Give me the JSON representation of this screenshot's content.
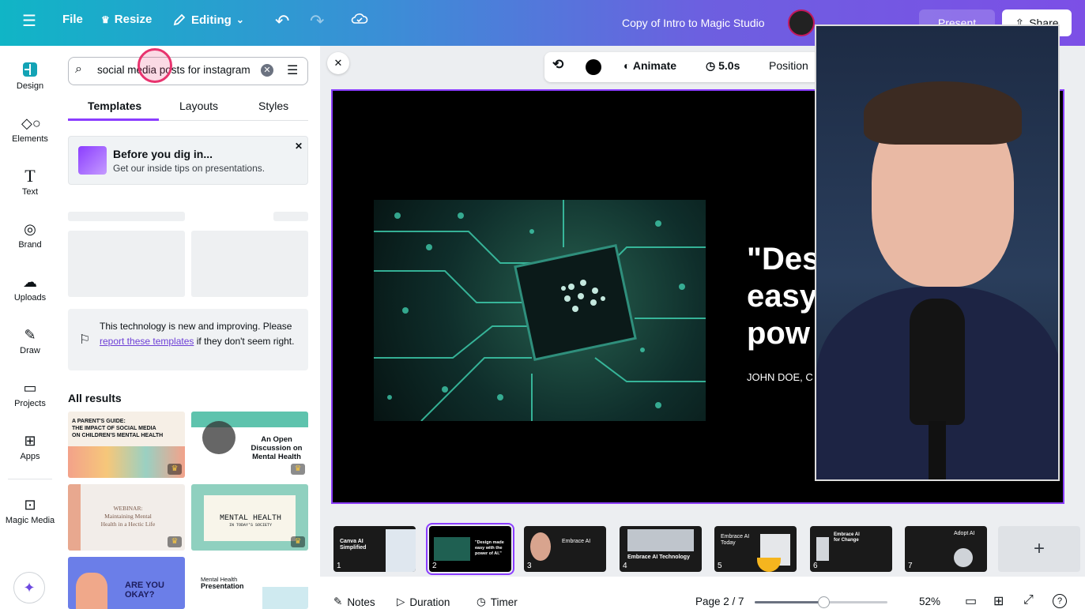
{
  "topbar": {
    "file_label": "File",
    "resize_label": "Resize",
    "editing_label": "Editing",
    "doc_title": "Copy of Intro to Magic Studio",
    "present_label": "Present",
    "share_label": "Share",
    "gradient_start": "#10b5c6",
    "gradient_end": "#7c4fe6"
  },
  "rail": {
    "items": [
      {
        "label": "Design",
        "icon": "design-icon"
      },
      {
        "label": "Elements",
        "icon": "elements-icon"
      },
      {
        "label": "Text",
        "icon": "text-icon"
      },
      {
        "label": "Brand",
        "icon": "brand-icon"
      },
      {
        "label": "Uploads",
        "icon": "uploads-icon"
      },
      {
        "label": "Draw",
        "icon": "draw-icon"
      },
      {
        "label": "Projects",
        "icon": "projects-icon"
      },
      {
        "label": "Apps",
        "icon": "apps-icon"
      },
      {
        "label": "Magic Media",
        "icon": "magic-media-icon"
      }
    ]
  },
  "panel": {
    "search_value": "social media posts for instagram",
    "tabs": [
      "Templates",
      "Layouts",
      "Styles"
    ],
    "tip_title": "Before you dig in...",
    "tip_body": "Get our inside tips on presentations.",
    "notice_text_1": "This technology is new and improving. Please",
    "notice_link": "report these templates",
    "notice_text_2": "if they don't seem",
    "notice_text_3": "right.",
    "results_heading": "All results",
    "results": [
      {
        "line1": "A PARENT'S GUIDE:",
        "line2": "THE IMPACT OF SOCIAL MEDIA",
        "line3": "ON CHILDREN'S MENTAL HEALTH"
      },
      {
        "line1": "An Open",
        "line2": "Discussion on",
        "line3": "Mental Health"
      },
      {
        "line1": "WEBINAR:",
        "line2": "Maintaining Mental",
        "line3": "Health in a Hectic Life"
      },
      {
        "line1": "MENTAL HEALTH",
        "line2": "IN TODAY'S SOCIETY",
        "line3": ""
      },
      {
        "line1": "ARE YOU OKAY?",
        "line2": "",
        "line3": ""
      },
      {
        "line1": "Mental Health",
        "line2": "Presentation",
        "line3": ""
      }
    ]
  },
  "canvas_toolbar": {
    "animate_label": "Animate",
    "duration_label": "5.0s",
    "position_label": "Position"
  },
  "slide": {
    "quote_line1": "\"Des",
    "quote_line2": "easy",
    "quote_line3": "pow",
    "attribution": "JOHN DOE, C"
  },
  "strip": {
    "thumbs": [
      {
        "num": "1",
        "text": "Canva AI Simplified"
      },
      {
        "num": "2",
        "text": "\"Design made easy with the power of AI.\""
      },
      {
        "num": "3",
        "text": "Embrace AI"
      },
      {
        "num": "4",
        "text": "Embrace AI Technology"
      },
      {
        "num": "5",
        "text": "Embrace AI Today"
      },
      {
        "num": "6",
        "text": "Embrace AI for Change"
      },
      {
        "num": "7",
        "text": "Adopt AI"
      }
    ],
    "add_label": "+"
  },
  "footer": {
    "notes_label": "Notes",
    "duration_label": "Duration",
    "timer_label": "Timer",
    "page_label": "Page 2 / 7",
    "zoom_label": "52%",
    "zoom_fraction": 0.52
  }
}
